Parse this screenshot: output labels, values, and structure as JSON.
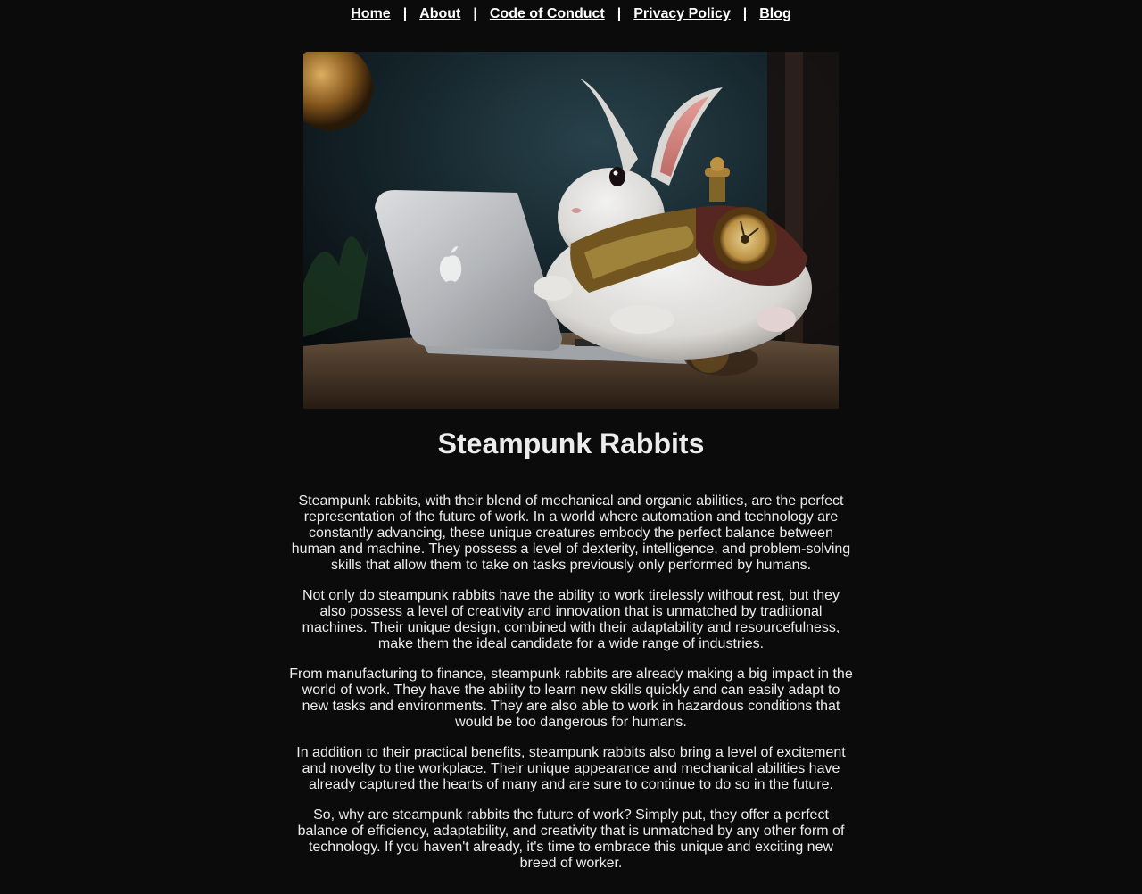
{
  "nav": {
    "items": [
      {
        "label": "Home"
      },
      {
        "label": "About"
      },
      {
        "label": "Code of Conduct"
      },
      {
        "label": "Privacy Policy"
      },
      {
        "label": "Blog"
      }
    ],
    "separator": "|"
  },
  "hero": {
    "icon": "steampunk-rabbit-laptop-image",
    "colors": {
      "background": "#0b0b0b",
      "text": "#ececec",
      "link": "#ffffff"
    }
  },
  "article": {
    "title": "Steampunk Rabbits",
    "paragraphs": [
      "Steampunk rabbits, with their blend of mechanical and organic abilities, are the perfect representation of the future of work. In a world where automation and technology are constantly advancing, these unique creatures embody the perfect balance between human and machine. They possess a level of dexterity, intelligence, and problem-solving skills that allow them to take on tasks previously only performed by humans.",
      "Not only do steampunk rabbits have the ability to work tirelessly without rest, but they also possess a level of creativity and innovation that is unmatched by traditional machines. Their unique design, combined with their adaptability and resourcefulness, make them the ideal candidate for a wide range of industries.",
      "From manufacturing to finance, steampunk rabbits are already making a big impact in the world of work. They have the ability to learn new skills quickly and can easily adapt to new tasks and environments. They are also able to work in hazardous conditions that would be too dangerous for humans.",
      "In addition to their practical benefits, steampunk rabbits also bring a level of excitement and novelty to the workplace. Their unique appearance and mechanical abilities have already captured the hearts of many and are sure to continue to do so in the future.",
      "So, why are steampunk rabbits the future of work? Simply put, they offer a perfect balance of efficiency, adaptability, and creativity that is unmatched by any other form of technology. If you haven't already, it's time to embrace this unique and exciting new breed of worker."
    ]
  }
}
